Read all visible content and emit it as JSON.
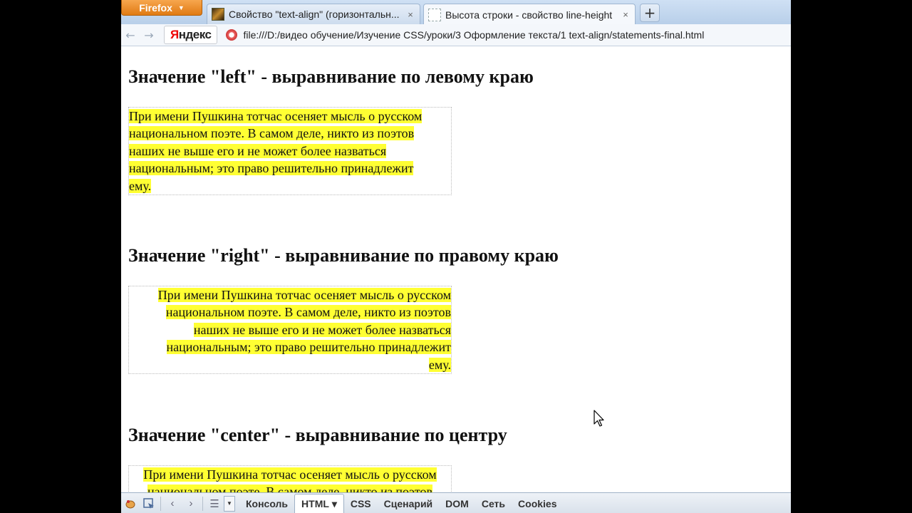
{
  "browser": {
    "menu_label": "Firefox",
    "tabs": [
      {
        "title": "Свойство \"text-align\" (горизонтальн...",
        "close": "×"
      },
      {
        "title": "Высота строки - свойство line-height",
        "close": "×"
      }
    ],
    "new_tab": "+",
    "nav": {
      "back": "←",
      "forward": "→"
    },
    "yandex": {
      "first": "Я",
      "rest": "ндекс"
    },
    "url": "file:///D:/видео обучение/Изучение CSS/уроки/3 Оформление текста/1 text-align/statements-final.html"
  },
  "page": {
    "sections": [
      {
        "heading": "Значение \"left\" - выравнивание по левому краю",
        "lines": [
          "При имени Пушкина тотчас осеняет мысль о русском",
          "национальном поэте. В самом деле, никто из поэтов",
          "наших не выше его и не может более назваться",
          "национальным; это право решительно принадлежит",
          "ему."
        ]
      },
      {
        "heading": "Значение \"right\" - выравнивание по правому краю",
        "lines": [
          "При имени Пушкина тотчас осеняет мысль о русском",
          "национальном поэте. В самом деле, никто из поэтов",
          "наших не выше его и не может более назваться",
          "национальным; это право решительно принадлежит",
          "ему."
        ]
      },
      {
        "heading": "Значение \"center\" - выравнивание по центру",
        "lines": [
          "При имени Пушкина тотчас осеняет мысль о русском",
          "национальном поэте. В самом деле, никто из поэтов"
        ]
      }
    ]
  },
  "firebug": {
    "tabs": [
      "Консоль",
      "HTML",
      "CSS",
      "Сценарий",
      "DOM",
      "Сеть",
      "Cookies"
    ],
    "active_arrow": "▾"
  },
  "colors": {
    "highlight": "#ffff33"
  }
}
